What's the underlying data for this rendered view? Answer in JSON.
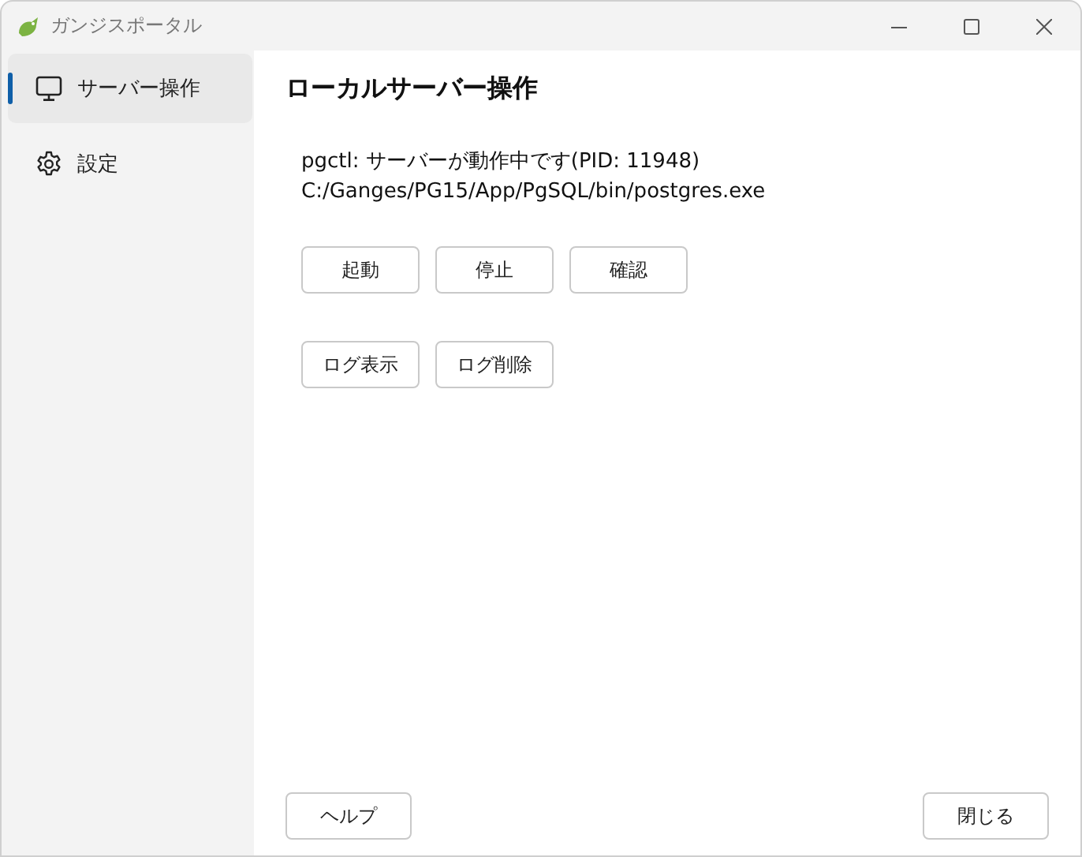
{
  "window": {
    "title": "ガンジスポータル"
  },
  "sidebar": {
    "items": [
      {
        "label": "サーバー操作",
        "selected": true,
        "kind": "monitor"
      },
      {
        "label": "設定",
        "selected": false,
        "kind": "gear"
      }
    ]
  },
  "content": {
    "heading": "ローカルサーバー操作",
    "status_lines": [
      "pgctl: サーバーが動作中です(PID: 11948)",
      "C:/Ganges/PG15/App/PgSQL/bin/postgres.exe"
    ],
    "button_rows": [
      [
        "起動",
        "停止",
        "確認"
      ],
      [
        "ログ表示",
        "ログ削除"
      ]
    ]
  },
  "footer": {
    "help_button": "ヘルプ",
    "close_button": "閉じる"
  }
}
